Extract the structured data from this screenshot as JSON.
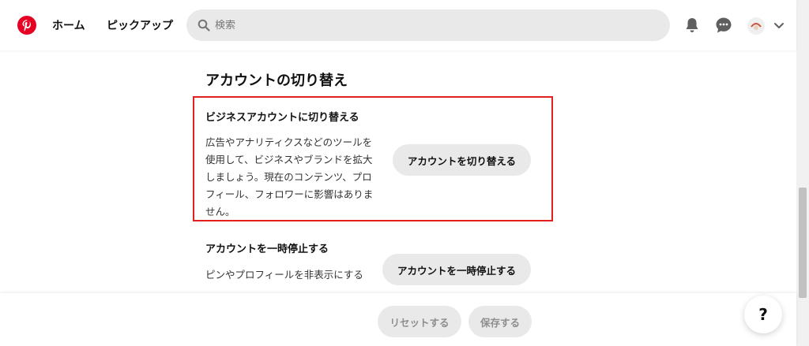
{
  "header": {
    "nav": {
      "home": "ホーム",
      "pickup": "ピックアップ"
    },
    "search": {
      "placeholder": "検索"
    },
    "icons": {
      "logo": "pinterest-logo-icon",
      "bell": "bell-icon",
      "chat": "chat-icon",
      "chevron": "chevron-down-icon"
    }
  },
  "main": {
    "section_title": "アカウントの切り替え",
    "business_card": {
      "title": "ビジネスアカウントに切り替える",
      "description": "広告やアナリティクスなどのツールを使用して、ビジネスやブランドを拡大しましょう。現在のコンテンツ、プロフィール、フォロワーに影響はありません。",
      "button_label": "アカウントを切り替える"
    },
    "deactivate_card": {
      "title": "アカウントを一時停止する",
      "description": "ピンやプロフィールを非表示にする",
      "button_label": "アカウントを一時停止する"
    }
  },
  "footer": {
    "reset_label": "リセットする",
    "save_label": "保存する"
  },
  "help": {
    "label": "?"
  },
  "colors": {
    "brand": "#e60023",
    "highlight_border": "#e32020",
    "button_bg": "#e9e9e9"
  }
}
